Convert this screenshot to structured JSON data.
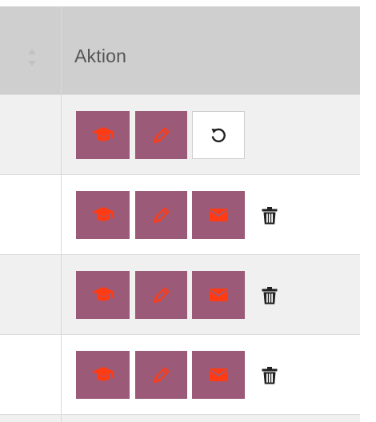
{
  "table": {
    "header": {
      "action_label": "Aktion"
    },
    "rows": [
      {
        "buttons": [
          "graduation-cap-icon",
          "pencil-icon",
          "undo-icon"
        ],
        "delete": false
      },
      {
        "buttons": [
          "graduation-cap-icon",
          "pencil-icon",
          "envelope-icon"
        ],
        "delete": true
      },
      {
        "buttons": [
          "graduation-cap-icon",
          "pencil-icon",
          "envelope-icon"
        ],
        "delete": true
      },
      {
        "buttons": [
          "graduation-cap-icon",
          "pencil-icon",
          "envelope-icon"
        ],
        "delete": true
      }
    ]
  },
  "colors": {
    "header_bg": "#cfcfcf",
    "action_button_bg": "#9b5a78",
    "icon_accent": "#ff3b14",
    "row_alt_bg": "#f0f0f0",
    "trash_color": "#222222"
  }
}
